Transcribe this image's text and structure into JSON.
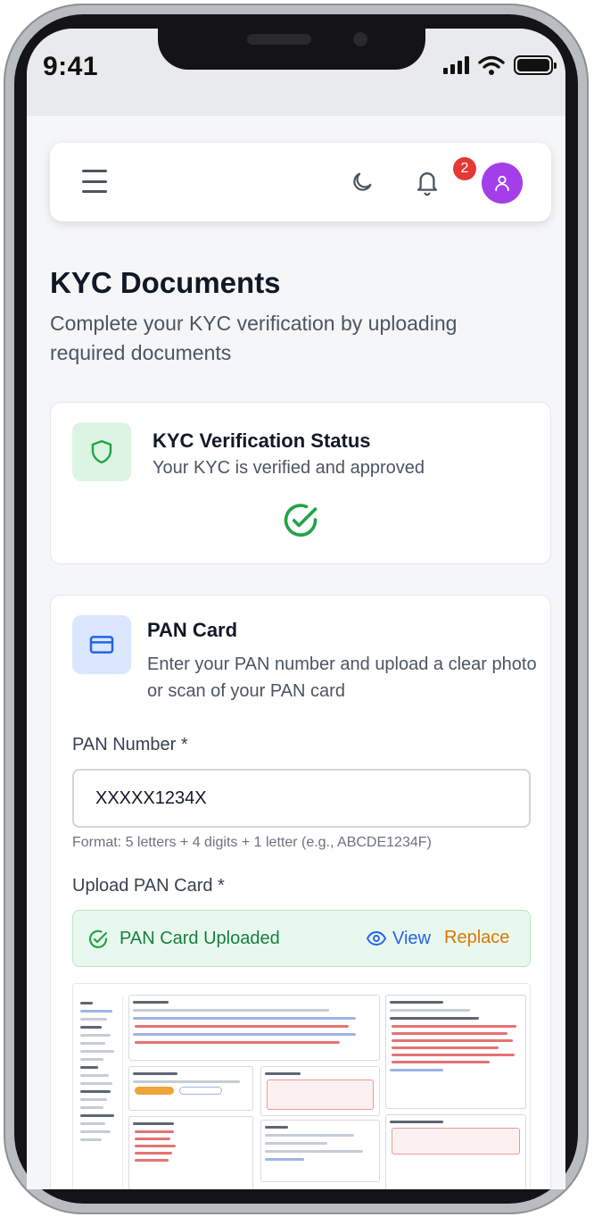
{
  "status_bar": {
    "time": "9:41"
  },
  "header": {
    "menu_icon": "hamburger-menu-icon",
    "theme_icon": "moon-icon",
    "notification_icon": "bell-icon",
    "notification_count": "2",
    "avatar_icon": "user-icon",
    "avatar_color": "#a33ee8"
  },
  "page": {
    "title": "KYC Documents",
    "subtitle": "Complete your KYC verification by uploading required documents"
  },
  "kyc_status": {
    "title": "KYC Verification Status",
    "description": "Your KYC is verified and approved",
    "icon": "shield-icon",
    "state_icon": "check-circle-icon",
    "accent_color": "#22a447"
  },
  "pan_card": {
    "title": "PAN Card",
    "description": "Enter your PAN number and upload a clear photo or scan of your PAN card",
    "icon": "credit-card-icon",
    "number_label": "PAN Number *",
    "number_value": "XXXXX1234X",
    "format_hint": "Format: 5 letters + 4 digits + 1 letter (e.g., ABCDE1234F)",
    "upload_label": "Upload PAN Card *",
    "upload_status": "PAN Card Uploaded",
    "view_label": "View",
    "replace_label": "Replace",
    "view_color": "#2563eb",
    "replace_color": "#d97706"
  }
}
